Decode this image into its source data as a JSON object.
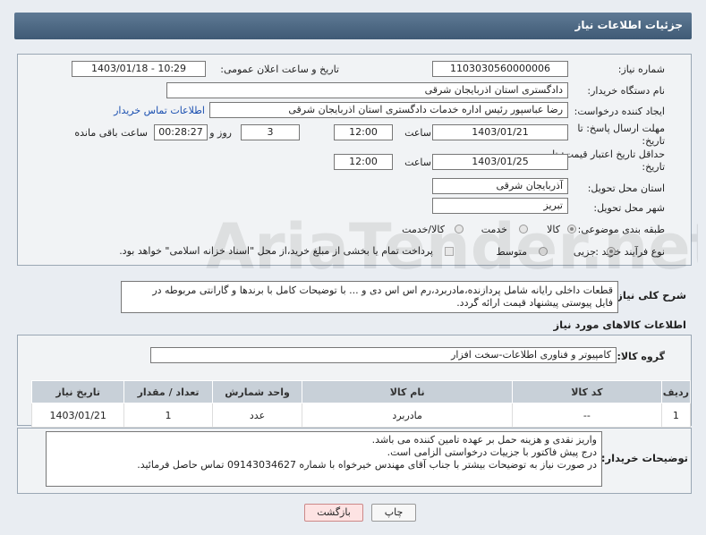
{
  "header": {
    "title": "جزئیات اطلاعات نیاز"
  },
  "fields": {
    "need_number_label": "شماره نیاز:",
    "need_number": "1103030560000006",
    "announce_label": "تاریخ و ساعت اعلان عمومی:",
    "announce_value": "1403/01/18 - 10:29",
    "buyer_org_label": "نام دستگاه خریدار:",
    "buyer_org": "دادگستری استان اذربایجان شرقی",
    "creator_label": "ایجاد کننده درخواست:",
    "creator": "رضا عباسپور رئیس اداره خدمات دادگستری استان اذربایجان شرقی",
    "contact_link": "اطلاعات تماس خریدار",
    "deadline_label_1": "مهلت ارسال پاسخ: تا",
    "deadline_label_2": "تاریخ:",
    "deadline_date": "1403/01/21",
    "time_label": "ساعت",
    "deadline_time": "12:00",
    "days_value": "3",
    "days_label": "روز و",
    "remaining_time": "00:28:27",
    "remaining_label": "ساعت باقی مانده",
    "validity_label_1": "حداقل تاریخ اعتبار قیمت: تا",
    "validity_label_2": "تاریخ:",
    "validity_date": "1403/01/25",
    "validity_time": "12:00",
    "province_label": "استان محل تحویل:",
    "province": "آذربایجان شرقی",
    "city_label": "شهر محل تحویل:",
    "city": "تبریز",
    "category_label": "طبقه بندی موضوعی:",
    "category_options": [
      "کالا",
      "خدمت",
      "کالا/خدمت"
    ],
    "purchase_label": "نوع فرآیند خرید :",
    "purchase_options": [
      "جزیی",
      "متوسط"
    ],
    "payment_note": "پرداخت تمام یا بخشی از مبلغ خرید،از محل \"اسناد خزانه اسلامی\" خواهد بود."
  },
  "description": {
    "label": "شرح کلی نیاز:",
    "text_line1": "قطعات داخلی رایانه شامل پردازنده،مادربرد،رم اس اس دی و ... با توضیحات کامل با برندها و گارانتی مربوطه در",
    "text_line2": "فایل پیوستی پیشنهاد قیمت ارائه گردد."
  },
  "goods": {
    "section_title": "اطلاعات کالاهای مورد نیاز",
    "group_label": "گروه کالا:",
    "group_value": "کامپیوتر و فناوری اطلاعات-سخت افزار",
    "columns": [
      "ردیف",
      "کد کالا",
      "نام کالا",
      "واحد شمارش",
      "تعداد / مقدار",
      "تاریخ نیاز"
    ],
    "rows": [
      [
        "1",
        "--",
        "مادربرد",
        "عدد",
        "1",
        "1403/01/21"
      ]
    ]
  },
  "buyer_notes": {
    "label": "توضیحات خریدار:",
    "line1": "واریز نقدی و هزینه حمل بر عهده تامین کننده می باشد.",
    "line2": "درج پیش فاکتور با جزییات درخواستی الزامی است.",
    "line3": "در صورت نیاز به توضیحات بیشتر با جناب آقای مهندس خیرخواه با شماره 09143034627 تماس حاصل فرمائید."
  },
  "buttons": {
    "print": "چاپ",
    "back": "بازگشت"
  },
  "watermark_text": "AriaTender.net"
}
